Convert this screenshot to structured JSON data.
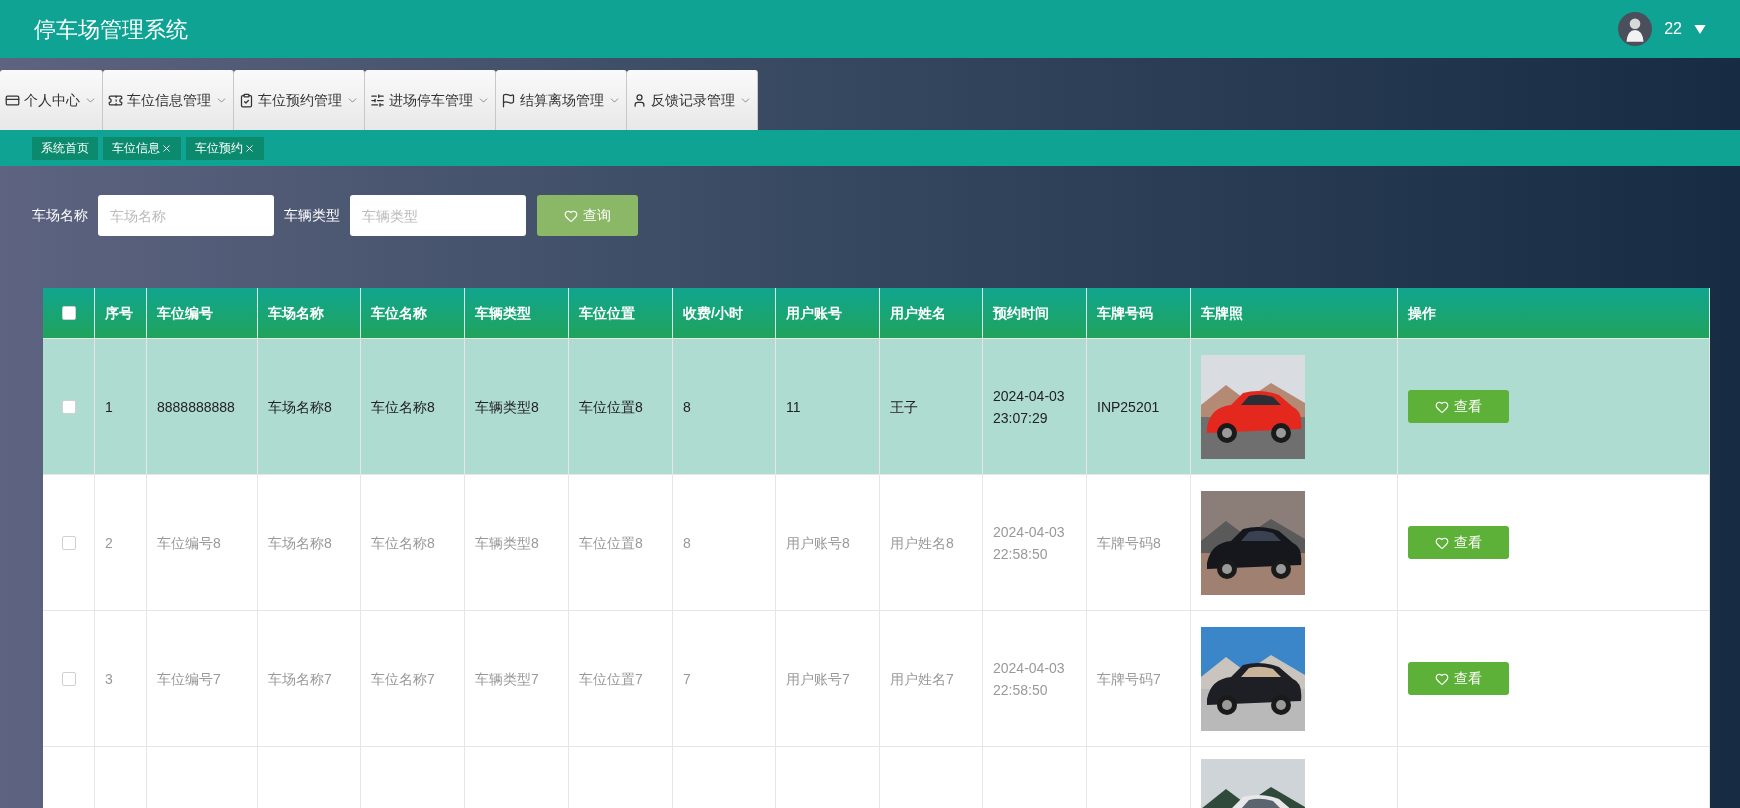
{
  "header": {
    "title": "停车场管理系统",
    "user": {
      "name": "22"
    }
  },
  "menu": [
    {
      "label": "个人中心"
    },
    {
      "label": "车位信息管理"
    },
    {
      "label": "车位预约管理"
    },
    {
      "label": "进场停车管理"
    },
    {
      "label": "结算离场管理"
    },
    {
      "label": "反馈记录管理"
    }
  ],
  "tags": [
    {
      "label": "系统首页",
      "closable": false
    },
    {
      "label": "车位信息",
      "closable": true
    },
    {
      "label": "车位预约",
      "closable": true
    }
  ],
  "search": {
    "fields": [
      {
        "label": "车场名称",
        "placeholder": "车场名称"
      },
      {
        "label": "车辆类型",
        "placeholder": "车辆类型"
      }
    ],
    "button": "查询"
  },
  "table": {
    "columns": [
      "序号",
      "车位编号",
      "车场名称",
      "车位名称",
      "车辆类型",
      "车位位置",
      "收费/小时",
      "用户账号",
      "用户姓名",
      "预约时间",
      "车牌号码",
      "车牌照",
      "操作"
    ],
    "header_checked": false,
    "rows": [
      {
        "selected": true,
        "checked": false,
        "cells": [
          "1",
          "8888888888",
          "车场名称8",
          "车位名称8",
          "车辆类型8",
          "车位位置8",
          "8",
          "11",
          "王子",
          "2024-04-03 23:07:29",
          "INP25201"
        ],
        "action": "查看"
      },
      {
        "selected": false,
        "checked": false,
        "cells": [
          "2",
          "车位编号8",
          "车场名称8",
          "车位名称8",
          "车辆类型8",
          "车位位置8",
          "8",
          "用户账号8",
          "用户姓名8",
          "2024-04-03 22:58:50",
          "车牌号码8"
        ],
        "action": "查看"
      },
      {
        "selected": false,
        "checked": false,
        "cells": [
          "3",
          "车位编号7",
          "车场名称7",
          "车位名称7",
          "车辆类型7",
          "车位位置7",
          "7",
          "用户账号7",
          "用户姓名7",
          "2024-04-03 22:58:50",
          "车牌号码7"
        ],
        "action": "查看"
      },
      {
        "selected": false
      }
    ]
  }
}
